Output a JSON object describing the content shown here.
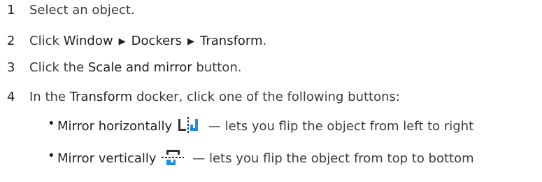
{
  "steps": [
    {
      "number": "1",
      "parts": [
        {
          "text": "Select an object.",
          "ui": false
        }
      ]
    },
    {
      "number": "2",
      "parts": [
        {
          "text": "Click ",
          "ui": false
        },
        {
          "text": "Window",
          "ui": true
        },
        {
          "arrow": true
        },
        {
          "text": "Dockers",
          "ui": true
        },
        {
          "arrow": true
        },
        {
          "text": "Transform",
          "ui": true
        },
        {
          "text": ".",
          "ui": false
        }
      ]
    },
    {
      "number": "3",
      "parts": [
        {
          "text": "Click the ",
          "ui": false
        },
        {
          "text": "Scale and mirror",
          "ui": true
        },
        {
          "text": " button.",
          "ui": false
        }
      ]
    },
    {
      "number": "4",
      "parts": [
        {
          "text": "In the ",
          "ui": false
        },
        {
          "text": "Transform",
          "ui": true
        },
        {
          "text": " docker, click one of the following buttons:",
          "ui": false
        }
      ]
    }
  ],
  "bullets": [
    {
      "label": "Mirror horizontally",
      "icon": "mirror-horizontal-icon",
      "description": " — lets you flip the object from left to right"
    },
    {
      "label": "Mirror vertically",
      "icon": "mirror-vertical-icon",
      "description": " — lets you flip the object from top to bottom"
    }
  ],
  "arrow_glyph": "▶",
  "colors": {
    "icon_blue": "#1a8fe3",
    "icon_dark": "#333333"
  }
}
